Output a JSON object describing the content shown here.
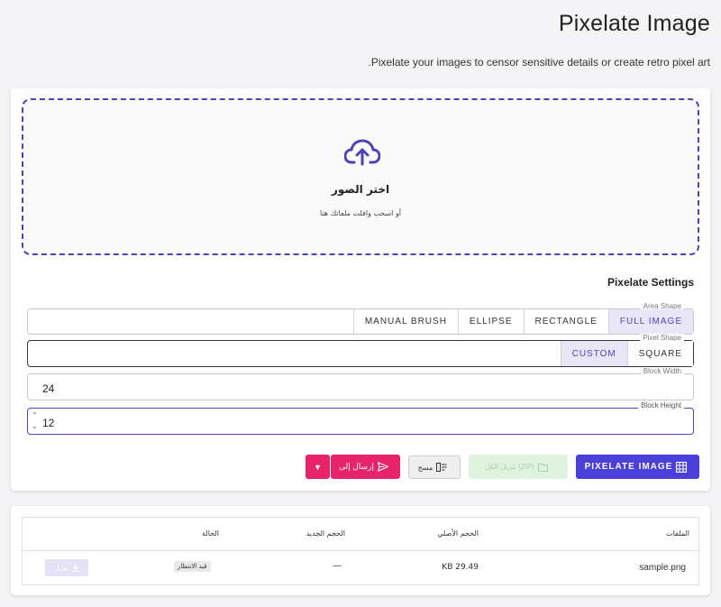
{
  "header": {
    "title": "Pixelate Image",
    "subtitle": ".Pixelate your images to censor sensitive details or create retro pixel art"
  },
  "dropzone": {
    "icon": "cloud-upload-icon",
    "title": "اختر الصور",
    "subtitle": "أو اسحب وافلت ملفاتك هنا"
  },
  "settings": {
    "title": "Pixelate Settings",
    "area_shape": {
      "label": "Area Shape",
      "options": [
        "FULL IMAGE",
        "RECTANGLE",
        "ELLIPSE",
        "MANUAL BRUSH"
      ],
      "selected": "FULL IMAGE"
    },
    "pixel_shape": {
      "label": "Pixel Shape",
      "options": [
        "SQUARE",
        "CUSTOM"
      ],
      "selected": "CUSTOM"
    },
    "block_width": {
      "label": "Block Width",
      "value": "24"
    },
    "block_height": {
      "label": "Block Height",
      "value": "12"
    }
  },
  "actions": {
    "pixelate_label": "PIXELATE IMAGE",
    "zip_label": "تنزيل الكل (ZIP)",
    "clear_label": "مسح",
    "send_label": "إرسال إلى"
  },
  "table": {
    "headers": {
      "files": "الملفات",
      "original_size": "الحجم الأصلي",
      "new_size": "الحجم الجديد",
      "status": "الحالة"
    },
    "rows": [
      {
        "name": "sample.png",
        "original_size": "KB 29.49",
        "new_size": "—",
        "status": "قيد الانتظار",
        "download_label": "تنزيل"
      }
    ]
  },
  "colors": {
    "primary": "#4a3fd9",
    "send": "#e6236b",
    "zip_disabled": "#dff3df",
    "selected_segment": "#e8e6f7"
  }
}
